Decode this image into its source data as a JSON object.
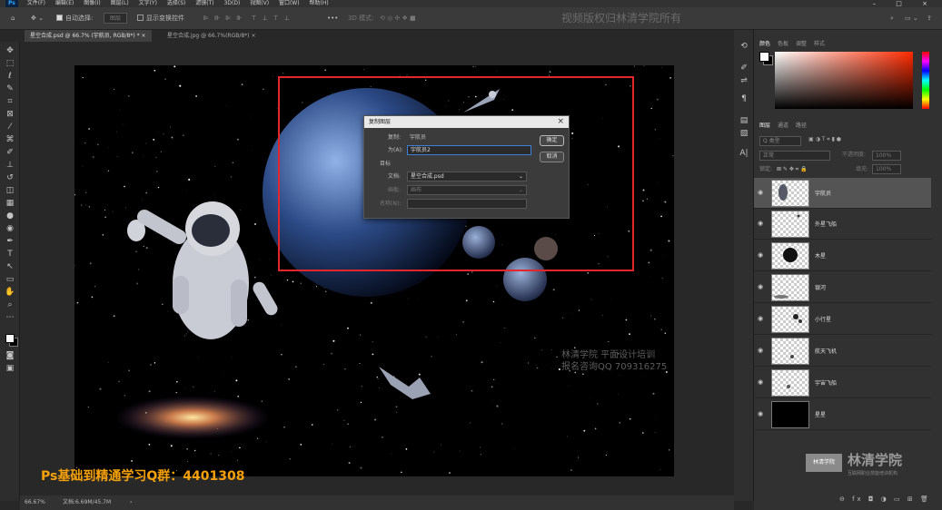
{
  "menu": {
    "app_icon": "Ps",
    "items": [
      "文件(F)",
      "编辑(E)",
      "图像(I)",
      "图层(L)",
      "文字(Y)",
      "选择(S)",
      "滤镜(T)",
      "3D(D)",
      "视图(V)",
      "窗口(W)",
      "帮助(H)"
    ]
  },
  "window_controls": "– □ ×",
  "options": {
    "auto_select_label": "自动选择:",
    "auto_select_value": "图层",
    "show_transform_label": "显示变换控件",
    "mode3d_label": "3D 模式:",
    "more": "•••"
  },
  "watermark_top": "视频版权归林清学院所有",
  "tabs": [
    {
      "label": "星空合成.psd @ 66.7% (宇航员, RGB/8*) *",
      "close": "×"
    },
    {
      "label": "星空合成.jpg @ 66.7%(RGB/8*)",
      "close": "×"
    }
  ],
  "dialog": {
    "title": "复制图层",
    "close": "×",
    "copy_label": "复制:",
    "copy_value": "宇航员",
    "as_label": "为(A):",
    "as_value": "宇航员2",
    "dest_label": "目标",
    "doc_label": "文档:",
    "doc_value": "星空合成.psd",
    "artboard_label": "画板:",
    "artboard_value": "画布",
    "name_label": "名称(N):",
    "name_value": "",
    "ok": "确定",
    "cancel": "取消"
  },
  "canvas_watermark": {
    "line1": "林清学院  平面设计培训",
    "line2": "报名咨询QQ 709316275"
  },
  "bottom_text": "Ps基础到精通学习Q群：4401308",
  "status": {
    "zoom": "66.67%",
    "doc": "文档:6.69M/45.7M",
    "arrow": "›"
  },
  "color_panel": {
    "tabs": [
      "颜色",
      "色板",
      "调整",
      "样式"
    ]
  },
  "layers_panel": {
    "tabs": [
      "图层",
      "通道",
      "路径"
    ],
    "kind": "Q 类型",
    "blend": "正常",
    "opacity_label": "不透明度:",
    "opacity": "100%",
    "lock_label": "锁定:",
    "fill_label": "填充:",
    "fill": "100%",
    "layers": [
      {
        "name": "宇航员",
        "selected": true
      },
      {
        "name": "外星飞船",
        "selected": false
      },
      {
        "name": "木星",
        "selected": false
      },
      {
        "name": "银河",
        "selected": false
      },
      {
        "name": "小行星",
        "selected": false
      },
      {
        "name": "航天飞机",
        "selected": false
      },
      {
        "name": "宇宙飞船",
        "selected": false
      },
      {
        "name": "星星",
        "selected": false
      }
    ],
    "footer_icons": "⊖ fx ◘ ◑ ▭ ⊞ 🗑"
  },
  "logo": {
    "badge": "林清学院",
    "title": "林清学院",
    "subtitle": "互联网职业技能培训机构"
  },
  "colors": {
    "accent_red": "#e3262c",
    "qq_orange": "#f6a10a",
    "ps_blue": "#31a8ff"
  }
}
